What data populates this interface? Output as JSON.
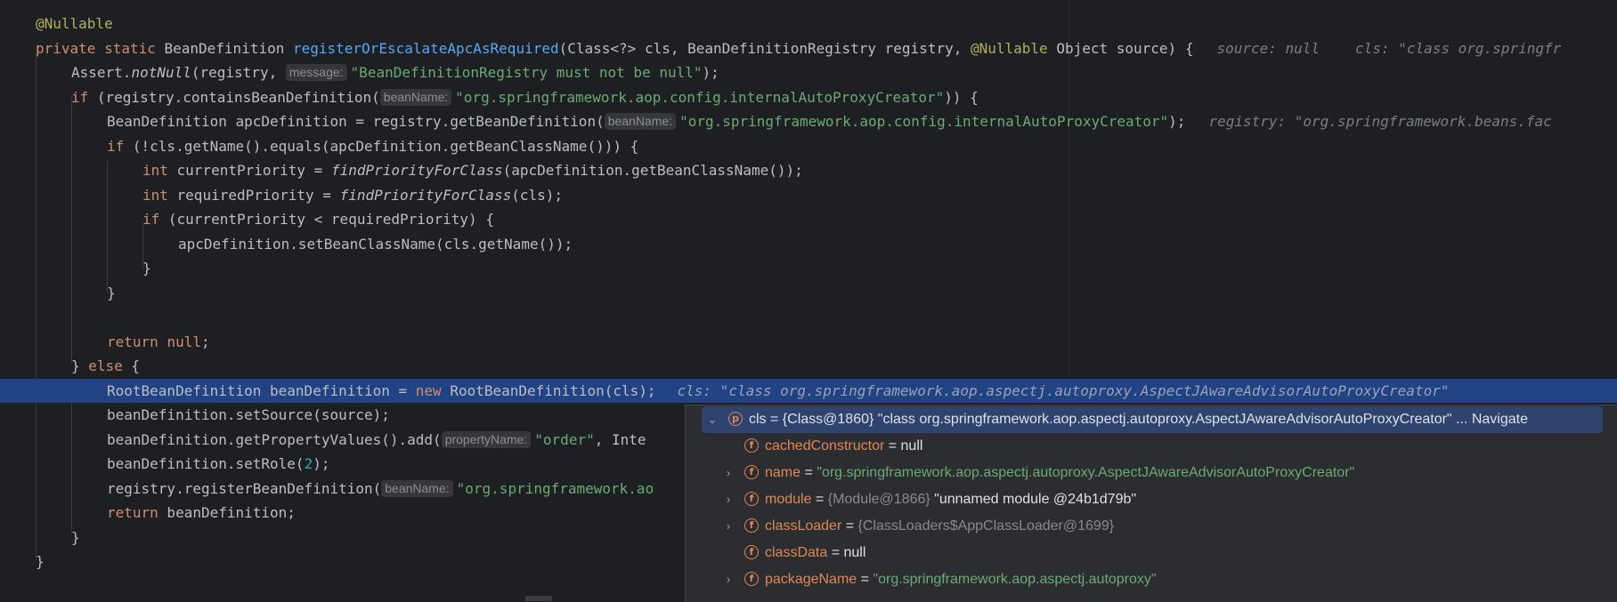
{
  "code": {
    "l1": {
      "annotation": "@Nullable"
    },
    "l2": {
      "kw": "private static",
      "type": " BeanDefinition ",
      "method": "registerOrEscalateApcAsRequired",
      "params_a": "(Class<?> cls, BeanDefinitionRegistry registry, ",
      "annot": "@Nullable",
      "params_b": " Object source) {",
      "inline_a": "source: null",
      "inline_b": "cls: \"class org.springfr"
    },
    "l3": {
      "pre": "Assert.",
      "method": "notNull",
      "args": "(registry, ",
      "hint": "message:",
      "str": "\"BeanDefinitionRegistry must not be null\"",
      "post": ");"
    },
    "l4": {
      "kw": "if",
      "pre": " (registry.containsBeanDefinition(",
      "hint": "beanName:",
      "str": "\"org.springframework.aop.config.internalAutoProxyCreator\"",
      "post": ")) {"
    },
    "l5": {
      "pre": "BeanDefinition apcDefinition = registry.getBeanDefinition(",
      "hint": "beanName:",
      "str": "\"org.springframework.aop.config.internalAutoProxyCreator\"",
      "post": ");",
      "inline": "registry: \"org.springframework.beans.fac"
    },
    "l6": {
      "kw": "if",
      "post": " (!cls.getName().equals(apcDefinition.getBeanClassName())) {"
    },
    "l7": {
      "kw": "int",
      "pre": " currentPriority = ",
      "method": "findPriorityForClass",
      "post": "(apcDefinition.getBeanClassName());"
    },
    "l8": {
      "kw": "int",
      "pre": " requiredPriority = ",
      "method": "findPriorityForClass",
      "post": "(cls);"
    },
    "l9": {
      "kw": "if",
      "post": " (currentPriority < requiredPriority) {"
    },
    "l10": {
      "text": "apcDefinition.setBeanClassName(cls.getName());"
    },
    "l11": {
      "text": "}"
    },
    "l12": {
      "text": "}"
    },
    "l14": {
      "kw": "return",
      "kw2": "null",
      "post": ";"
    },
    "l15": {
      "pre": "} ",
      "kw": "else",
      "post": " {"
    },
    "l16": {
      "pre": "RootBeanDefinition beanDefinition = ",
      "kw": "new",
      "post": " RootBeanDefinition(cls);",
      "inline": "cls: \"class org.springframework.aop.aspectj.autoproxy.AspectJAwareAdvisorAutoProxyCreator\""
    },
    "l17": {
      "text": "beanDefinition.setSource(source);"
    },
    "l18": {
      "pre": "beanDefinition.getPropertyValues().add(",
      "hint": "propertyName:",
      "str": "\"order\"",
      "post": ", Inte"
    },
    "l19": {
      "pre": "beanDefinition.setRole(",
      "num": "2",
      "post": ");"
    },
    "l20": {
      "pre": "registry.registerBeanDefinition(",
      "hint": "beanName:",
      "str": "\"org.springframework.ao"
    },
    "l21": {
      "kw": "return",
      "post": " beanDefinition;"
    },
    "l22": {
      "text": "}"
    },
    "l23": {
      "text": "}"
    }
  },
  "popup": {
    "rows": [
      {
        "icon": "p",
        "name": "cls",
        "eq": " = ",
        "type": "{Class@1860}",
        "value": " \"class org.springframework.aop.aspectj.autoproxy.AspectJAwareAdvisorAutoProxyCreator\"",
        "suffix": " ... Navigate",
        "expanded": true
      },
      {
        "icon": "f",
        "name": "cachedConstructor",
        "eq": " = ",
        "value": "null"
      },
      {
        "icon": "f",
        "name": "name",
        "eq": " = ",
        "value": "\"org.springframework.aop.aspectj.autoproxy.AspectJAwareAdvisorAutoProxyCreator\""
      },
      {
        "icon": "f",
        "name": "module",
        "eq": " = ",
        "type": "{Module@1866}",
        "value": " \"unnamed module @24b1d79b\""
      },
      {
        "icon": "f",
        "name": "classLoader",
        "eq": " = ",
        "type": "{ClassLoaders$AppClassLoader@1699}"
      },
      {
        "icon": "f",
        "name": "classData",
        "eq": " = ",
        "value": "null"
      },
      {
        "icon": "f",
        "name": "packageName",
        "eq": " = ",
        "value": "\"org.springframework.aop.aspectj.autoproxy\""
      }
    ]
  }
}
